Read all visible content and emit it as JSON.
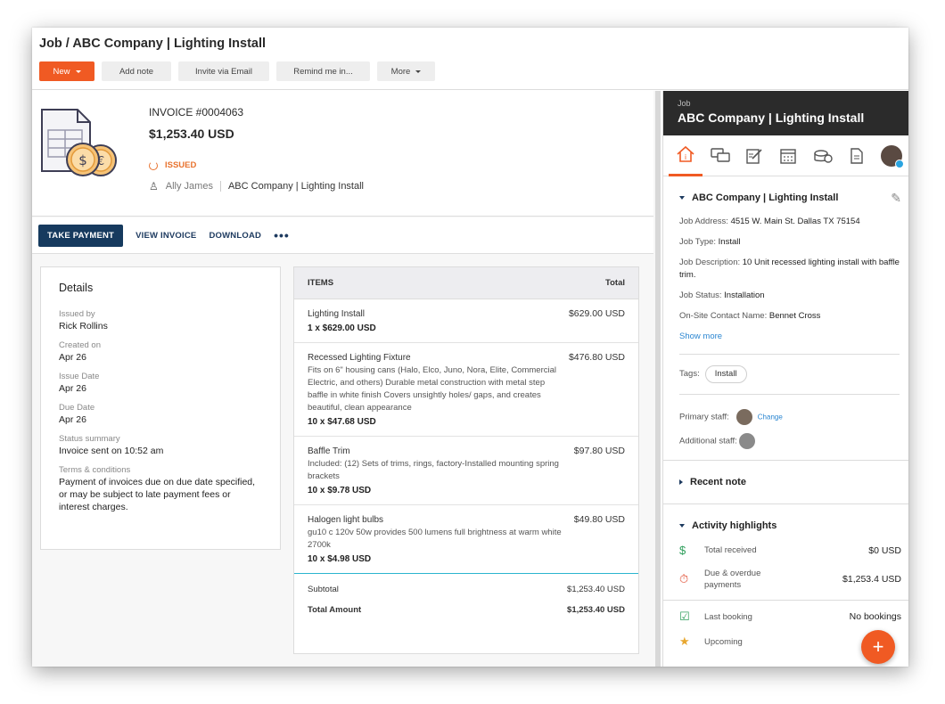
{
  "header": {
    "title": "Job / ABC Company | Lighting Install",
    "buttons": {
      "new": "New",
      "add_note": "Add note",
      "invite": "Invite via Email",
      "remind": "Remind me in...",
      "more": "More"
    }
  },
  "invoice": {
    "number": "INVOICE #0004063",
    "amount": "$1,253.40 USD",
    "status": "ISSUED",
    "owner": "Ally James",
    "company": "ABC Company | Lighting Install",
    "actions": {
      "take_payment": "TAKE PAYMENT",
      "view_invoice": "VIEW INVOICE",
      "download": "DOWNLOAD",
      "more": "•••"
    }
  },
  "details": {
    "title": "Details",
    "fields": [
      {
        "k": "Issued by",
        "v": "Rick Rollins"
      },
      {
        "k": "Created on",
        "v": "Apr 26"
      },
      {
        "k": "Issue Date",
        "v": "Apr 26"
      },
      {
        "k": "Due Date",
        "v": "Apr 26"
      },
      {
        "k": "Status summary",
        "v": "Invoice sent on 10:52 am"
      },
      {
        "k": "Terms & conditions",
        "v": "Payment of invoices due on due date specified, or may be subject to late payment fees or interest charges."
      }
    ]
  },
  "items": {
    "header_items": "ITEMS",
    "header_total": "Total",
    "rows": [
      {
        "name": "Lighting Install",
        "desc": "",
        "qty": "1 x $629.00 USD",
        "amt": "$629.00 USD"
      },
      {
        "name": "Recessed Lighting Fixture",
        "desc": "Fits on 6\" housing cans (Halo, Elco, Juno, Nora, Elite, Commercial Electric, and others) Durable metal construction with metal step baffle in white finish Covers unsightly holes/ gaps, and creates beautiful, clean appearance",
        "qty": "10 x $47.68 USD",
        "amt": "$476.80 USD"
      },
      {
        "name": "Baffle Trim",
        "desc": "Included: (12) Sets of trims, rings, factory-Installed mounting spring brackets",
        "qty": "10 x $9.78 USD",
        "amt": "$97.80 USD"
      },
      {
        "name": "Halogen light bulbs",
        "desc": "gu10 c 120v 50w provides 500 lumens full brightness at warm white 2700k",
        "qty": "10 x $4.98 USD",
        "amt": "$49.80 USD"
      }
    ],
    "subtotal_label": "Subtotal",
    "subtotal": "$1,253.40 USD",
    "total_label": "Total Amount",
    "total": "$1,253.40 USD"
  },
  "panel": {
    "sub": "Job",
    "title": "ABC Company | Lighting Install",
    "section_title": "ABC Company | Lighting Install",
    "job_address_k": "Job Address:",
    "job_address_v": "4515 W. Main St. Dallas TX 75154",
    "job_type_k": "Job Type:",
    "job_type_v": "Install",
    "job_desc_k": "Job Description:",
    "job_desc_v": "10 Unit recessed lighting install with baffle trim.",
    "job_status_k": "Job Status:",
    "job_status_v": "Installation",
    "contact_k": "On-Site Contact Name:",
    "contact_v": "Bennet Cross",
    "show_more": "Show more",
    "tags_k": "Tags:",
    "tag": "Install",
    "primary_staff": "Primary staff:",
    "change": "Change",
    "additional_staff": "Additional staff:",
    "recent_note": "Recent note",
    "activity": "Activity highlights",
    "hl": [
      {
        "label": "Total received",
        "val": "$0 USD"
      },
      {
        "label": "Due & overdue payments",
        "val": "$1,253.4 USD"
      },
      {
        "label": "Last booking",
        "val": "No bookings"
      },
      {
        "label": "Upcoming",
        "val": ""
      }
    ]
  },
  "fab": "+"
}
